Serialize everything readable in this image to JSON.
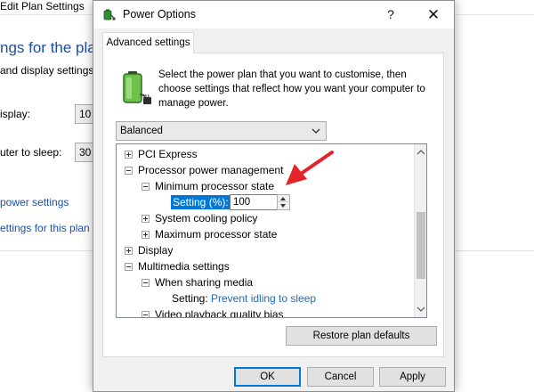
{
  "background_window": {
    "title": "Edit Plan Settings",
    "heading": "ngs for the plan:",
    "subtitle": "and display settings",
    "display_label": "isplay:",
    "display_value": "10",
    "sleep_label": "uter to sleep:",
    "sleep_value": "30",
    "link_power_settings": "power settings",
    "link_settings_plan": "ettings for this plan"
  },
  "dialog": {
    "title": "Power Options",
    "help_glyph": "?",
    "close_glyph": "✕",
    "tab_label": "Advanced settings",
    "intro_text": "Select the power plan that you want to customise, then choose settings that reflect how you want your computer to manage power.",
    "plan_selected": "Balanced",
    "tree": {
      "pci_express": "PCI Express",
      "processor_power_management": "Processor power management",
      "min_processor_state": "Minimum processor state",
      "setting_label": "Setting (%):",
      "setting_value": "100",
      "system_cooling_policy": "System cooling policy",
      "max_processor_state": "Maximum processor state",
      "display": "Display",
      "multimedia_settings": "Multimedia settings",
      "when_sharing_media": "When sharing media",
      "sharing_setting_label": "Setting:",
      "sharing_setting_value": "Prevent idling to sleep",
      "video_playback_bias": "Video playback quality bias"
    },
    "buttons": {
      "restore": "Restore plan defaults",
      "ok": "OK",
      "cancel": "Cancel",
      "apply": "Apply"
    }
  },
  "colors": {
    "accent_blue": "#0078d7",
    "link_blue": "#1a6cc4",
    "annotation_red": "#e3242b"
  },
  "icons": {
    "app_icon": "power-options-icon",
    "battery_icon": "battery-plug-icon"
  }
}
